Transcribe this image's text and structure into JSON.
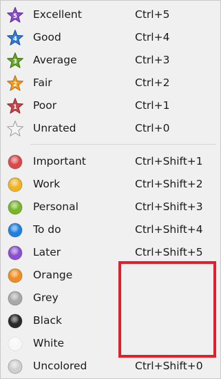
{
  "ratings": [
    {
      "name": "rating-excellent",
      "label": "Excellent",
      "shortcut": "Ctrl+5",
      "star_color": "#8a4fc8",
      "star_stroke": "#5a2c8e",
      "num": "5"
    },
    {
      "name": "rating-good",
      "label": "Good",
      "shortcut": "Ctrl+4",
      "star_color": "#2f7bd6",
      "star_stroke": "#1c4f93",
      "num": "4"
    },
    {
      "name": "rating-average",
      "label": "Average",
      "shortcut": "Ctrl+3",
      "star_color": "#63a524",
      "star_stroke": "#3e6e14",
      "num": "3"
    },
    {
      "name": "rating-fair",
      "label": "Fair",
      "shortcut": "Ctrl+2",
      "star_color": "#f29b1e",
      "star_stroke": "#b56a08",
      "num": "2"
    },
    {
      "name": "rating-poor",
      "label": "Poor",
      "shortcut": "Ctrl+1",
      "star_color": "#c9484d",
      "star_stroke": "#8a2327",
      "num": "1"
    },
    {
      "name": "rating-unrated",
      "label": "Unrated",
      "shortcut": "Ctrl+0",
      "star_color": "#f4f4f4",
      "star_stroke": "#9a9a9a",
      "num": ""
    }
  ],
  "labels": [
    {
      "name": "label-important",
      "label": "Important",
      "shortcut": "Ctrl+Shift+1",
      "color": "#d9494b"
    },
    {
      "name": "label-work",
      "label": "Work",
      "shortcut": "Ctrl+Shift+2",
      "color": "#f0b323"
    },
    {
      "name": "label-personal",
      "label": "Personal",
      "shortcut": "Ctrl+Shift+3",
      "color": "#78b52a"
    },
    {
      "name": "label-to-do",
      "label": "To do",
      "shortcut": "Ctrl+Shift+4",
      "color": "#1f80e0"
    },
    {
      "name": "label-later",
      "label": "Later",
      "shortcut": "Ctrl+Shift+5",
      "color": "#8a4fd0"
    },
    {
      "name": "label-orange",
      "label": "Orange",
      "shortcut": "",
      "color": "#ef8d1f"
    },
    {
      "name": "label-grey",
      "label": "Grey",
      "shortcut": "",
      "color": "#a9a9a9"
    },
    {
      "name": "label-black",
      "label": "Black",
      "shortcut": "",
      "color": "#2a2a2a"
    },
    {
      "name": "label-white",
      "label": "White",
      "shortcut": "",
      "color": "#f7f7f7"
    },
    {
      "name": "label-uncolored",
      "label": "Uncolored",
      "shortcut": "Ctrl+Shift+0",
      "color": "#cfcfcf"
    }
  ],
  "highlight_color": "#e0202a"
}
